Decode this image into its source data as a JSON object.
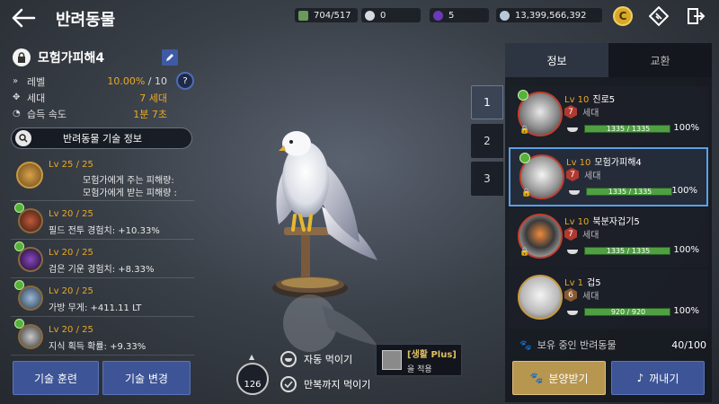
{
  "header": {
    "title": "반려동물",
    "resources": [
      "704/517",
      "0",
      "5",
      "13,399,566,392"
    ],
    "coin_label": "C"
  },
  "pet": {
    "name": "모험가피해4",
    "level_label": "레벨",
    "level_value": "10.00%",
    "level_max": "/ 10",
    "gen_label": "세대",
    "gen_value": "7 세대",
    "speed_label": "습득 속도",
    "speed_value": "1분 7초"
  },
  "skill_info_button": "반려동물 기술 정보",
  "skills": [
    {
      "lv": "Lv 25 / 25",
      "desc1": "모험가에게 주는 피해량:",
      "desc2": "모험가에게 받는 피해량 :"
    },
    {
      "lv": "Lv 20 / 25",
      "desc": "필드 전투 경험치: +10.33%",
      "color": "#7a3a2a"
    },
    {
      "lv": "Lv 20 / 25",
      "desc": "검은 기운 경험치: +8.33%",
      "color": "#3a2a5a"
    },
    {
      "lv": "Lv 20 / 25",
      "desc": "가방 무게: +411.11 LT",
      "color": "#4a6a8a"
    },
    {
      "lv": "Lv 20 / 25",
      "desc": "지식 획득 확률: +9.33%",
      "color": "#6a6a6a"
    }
  ],
  "buttons": {
    "train": "기술 훈련",
    "change": "기술 변경",
    "adopt": "분양받기",
    "withdraw": "꺼내기"
  },
  "feed": {
    "count": "126",
    "auto": "자동 먹이기",
    "full": "만복까지 먹이기",
    "life_plus": "[생활 Plus]",
    "life_plus_sub": "을 적용"
  },
  "page_tabs": [
    "1",
    "2",
    "3"
  ],
  "tabs": {
    "info": "정보",
    "trade": "교환"
  },
  "pet_list": [
    {
      "lv": "Lv 10",
      "name": "진로5",
      "gen": "7",
      "gen_label": "세대",
      "hp": "1335 / 1335",
      "hp_fraction": 1.0,
      "pct": "100%"
    },
    {
      "lv": "Lv 10",
      "name": "모험가피해4",
      "gen": "7",
      "gen_label": "세대",
      "hp": "1335 / 1335",
      "hp_fraction": 1.0,
      "pct": "100%"
    },
    {
      "lv": "Lv 10",
      "name": "북분자겁기5",
      "gen": "7",
      "gen_label": "세대",
      "hp": "1335 / 1335",
      "hp_fraction": 1.0,
      "pct": "100%"
    },
    {
      "lv": "Lv 1",
      "name": "겁5",
      "gen": "6",
      "gen_label": "세대",
      "hp": "920 / 920",
      "hp_fraction": 1.0,
      "pct": "100%"
    }
  ],
  "owned": {
    "label": "보유 중인 반려동물",
    "count": "40/100"
  },
  "colors": {
    "accent_gold": "#e9a924",
    "button_blue": "#3d5597",
    "button_gold": "#b7964f",
    "selected_border": "#5aa0e6",
    "hp_green": "#4ea040"
  }
}
